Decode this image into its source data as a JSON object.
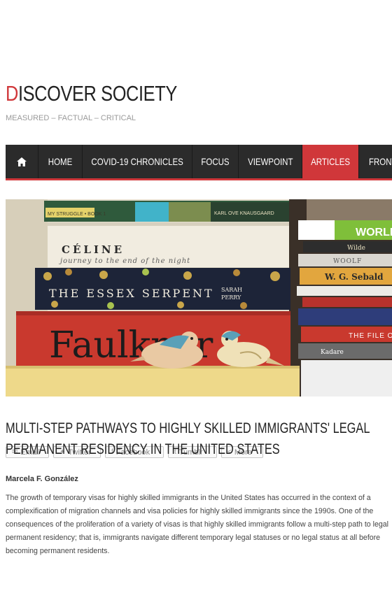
{
  "site": {
    "title_first_letter": "D",
    "title_rest": "ISCOVER SOCIETY",
    "tagline": "MEASURED – FACTUAL – CRITICAL"
  },
  "nav": {
    "items": [
      {
        "label": "HOME"
      },
      {
        "label": "COVID-19 CHRONICLES"
      },
      {
        "label": "FOCUS"
      },
      {
        "label": "VIEWPOINT"
      },
      {
        "label": "ARTICLES",
        "active": true
      },
      {
        "label": "FRONT"
      }
    ],
    "accent_color": "#d0373a",
    "background_color": "#2b2b2b"
  },
  "hero": {
    "book_spines": [
      "MY STRUGGLE • BOOK 1",
      "KARL OVE KNAUSGAARD",
      "CÉLINE",
      "journey to the end of the night",
      "THE ESSEX SERPENT",
      "SARAH",
      "PERRY",
      "Faulkner",
      "WORLD",
      "Wilde",
      "WOOLF",
      "W. G. Sebald",
      "THE FILE O",
      "Kadare"
    ]
  },
  "article": {
    "title": "MULTI-STEP PATHWAYS TO HIGHLY SKILLED IMMIGRANTS' LEGAL PERMANENT RESIDENCY IN THE UNITED STATES",
    "share_buttons": [
      {
        "label": "Email",
        "icon": "email-icon"
      },
      {
        "label": "Twitter",
        "icon": "twitter-icon"
      },
      {
        "label": "Facebook",
        "icon": "facebook-icon"
      },
      {
        "label": "Tumblr",
        "icon": "tumblr-icon"
      },
      {
        "label": "More",
        "icon": "share-icon"
      }
    ],
    "author": "Marcela F. González",
    "excerpt": "The growth of temporary visas for highly skilled immigrants in the United States has occurred in the context of a complexification of migration channels and visa policies for highly skilled immigrants since the 1990s. One of the consequences of the proliferation of a variety of visas is that highly skilled immigrants follow a multi-step path to legal permanent residency; that is, immigrants navigate different temporary legal statuses or no legal status at all before becoming permanent residents."
  }
}
